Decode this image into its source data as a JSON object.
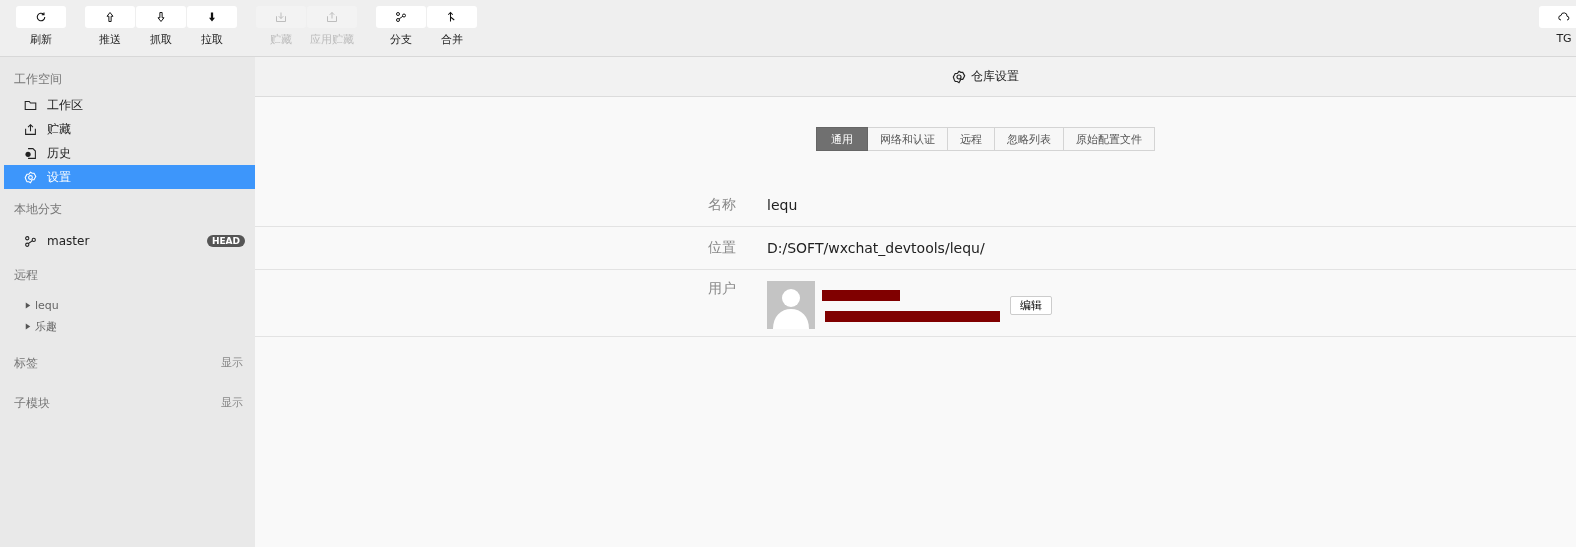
{
  "toolbar": {
    "groups": [
      [
        {
          "label": "刷新",
          "disabled": false
        }
      ],
      [
        {
          "label": "推送",
          "disabled": false
        },
        {
          "label": "抓取",
          "disabled": false
        },
        {
          "label": "拉取",
          "disabled": false
        }
      ],
      [
        {
          "label": "贮藏",
          "disabled": true
        },
        {
          "label": "应用贮藏",
          "disabled": true
        }
      ],
      [
        {
          "label": "分支",
          "disabled": false
        },
        {
          "label": "合并",
          "disabled": false
        }
      ]
    ],
    "right": {
      "label": "TG"
    }
  },
  "sidebar": {
    "workspace": {
      "title": "工作空间",
      "items": [
        {
          "label": "工作区",
          "selected": false
        },
        {
          "label": "贮藏",
          "selected": false
        },
        {
          "label": "历史",
          "selected": false
        },
        {
          "label": "设置",
          "selected": true
        }
      ]
    },
    "branches": {
      "title": "本地分支",
      "items": [
        {
          "label": "master",
          "badge": "HEAD"
        }
      ]
    },
    "remotes": {
      "title": "远程",
      "items": [
        {
          "label": "lequ",
          "expanded": false
        },
        {
          "label": "乐趣",
          "expanded": false
        }
      ]
    },
    "tags": {
      "title": "标签",
      "action": "显示"
    },
    "submodules": {
      "title": "子模块",
      "action": "显示"
    }
  },
  "main": {
    "header": {
      "title": "仓库设置"
    },
    "tabs": [
      {
        "label": "通用",
        "selected": true
      },
      {
        "label": "网络和认证",
        "selected": false
      },
      {
        "label": "远程",
        "selected": false
      },
      {
        "label": "忽略列表",
        "selected": false
      },
      {
        "label": "原始配置文件",
        "selected": false
      }
    ],
    "fields": [
      {
        "kind": "text",
        "label": "名称",
        "value": "lequ"
      },
      {
        "kind": "text",
        "label": "位置",
        "value": "D:/SOFT/wxchat_devtools/lequ/"
      },
      {
        "kind": "user",
        "label": "用户",
        "button": "编辑"
      }
    ]
  }
}
